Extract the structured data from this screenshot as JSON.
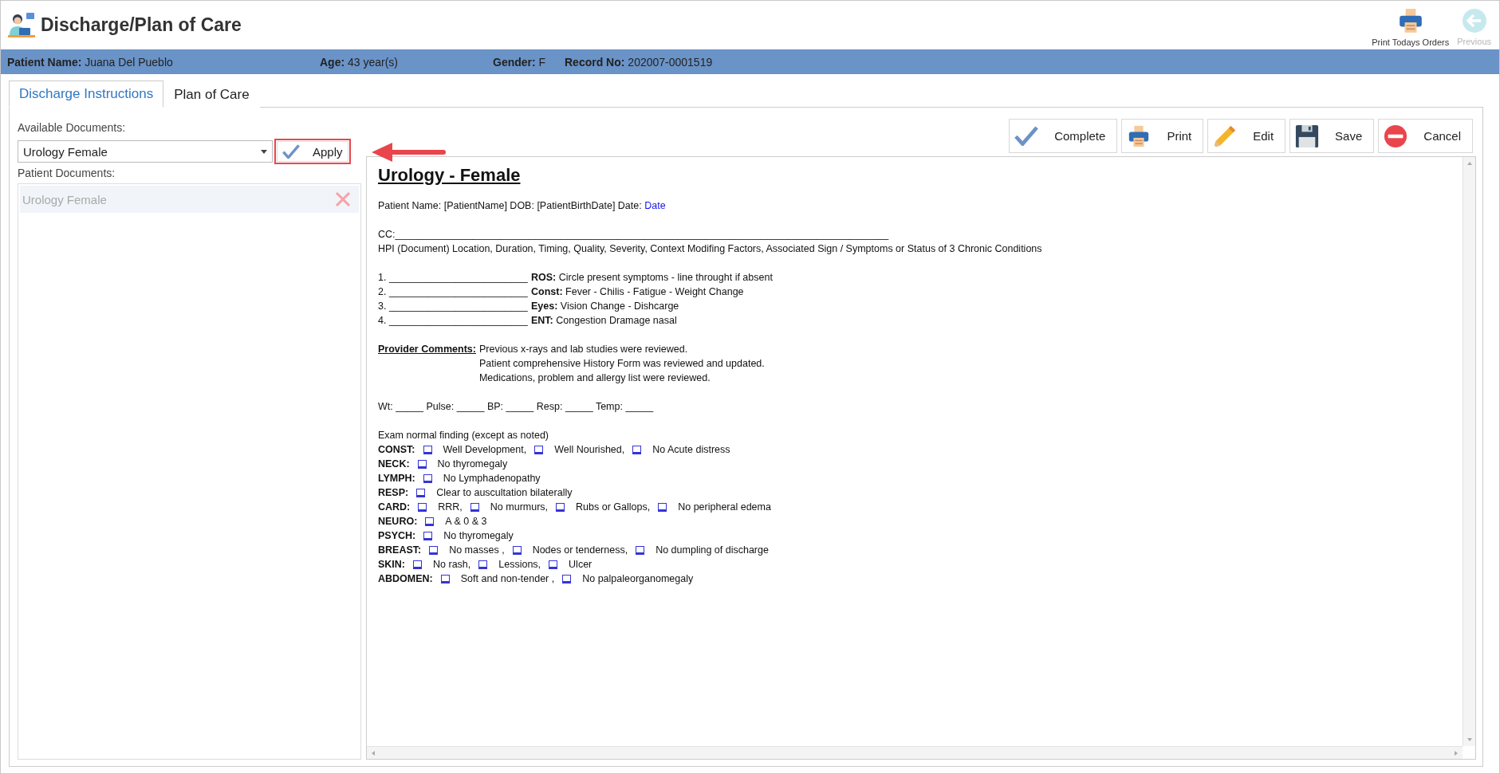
{
  "header": {
    "title": "Discharge/Plan of Care",
    "actions": [
      {
        "label": "Print Todays Orders",
        "disabled": false
      },
      {
        "label": "Previous",
        "disabled": true
      }
    ]
  },
  "patient_bar": [
    {
      "label": "Patient Name:",
      "value": "Juana Del Pueblo"
    },
    {
      "label": "Age:",
      "value": "43 year(s)"
    },
    {
      "label": "Gender:",
      "value": "F"
    },
    {
      "label": "Record No:",
      "value": "202007-0001519"
    }
  ],
  "tabs": [
    {
      "label": "Discharge Instructions",
      "selected": true
    },
    {
      "label": "Plan of Care",
      "selected": false
    }
  ],
  "available_documents": {
    "label": "Available Documents:",
    "value": "Urology Female",
    "apply": "Apply"
  },
  "patient_documents": {
    "label": "Patient Documents:",
    "items": [
      {
        "name": "Urology Female",
        "selected": true
      }
    ]
  },
  "toolbar": [
    "Complete",
    "Print",
    "Edit",
    "Save",
    "Cancel"
  ],
  "document": {
    "title": "Urology - Female",
    "header_line": {
      "text": "Patient Name: [PatientName] DOB: [PatientBirthDate] Date:",
      "link": "Date"
    },
    "cc": "CC:_________________________________________________________________________________________",
    "hpi": "HPI (Document) Location, Duration, Timing, Quality, Severity, Context Modifing Factors, Associated Sign / Symptoms or Status of 3 Chronic Conditions",
    "review": [
      {
        "number": "1.",
        "blank": "_________________________",
        "label": "ROS:",
        "text": "Circle present symptoms - line throught if absent"
      },
      {
        "number": "2.",
        "blank": "_________________________",
        "label": "Const:",
        "text": "Fever - Chilis - Fatigue - Weight Change"
      },
      {
        "number": "3.",
        "blank": "_________________________",
        "label": "Eyes:",
        "text": "Vision Change - Dishcarge"
      },
      {
        "number": "4.",
        "blank": "_________________________",
        "label": "ENT:",
        "text": "Congestion Dramage nasal"
      }
    ],
    "provider_comments": {
      "label": "Provider Comments:",
      "lines": [
        "Previous x-rays and lab studies were reviewed.",
        "Patient comprehensive History Form was reviewed and updated.",
        "Medications, problem and allergy list were reviewed."
      ]
    },
    "vitals": "Wt: _____ Pulse: _____ BP: _____ Resp: _____ Temp: _____",
    "exam": {
      "heading": "Exam normal finding (except as noted)",
      "rows": [
        {
          "label": "CONST:",
          "items": [
            {
              "text": "Well Development,",
              "checked": false
            },
            {
              "text": "Well Nourished,",
              "checked": false
            },
            {
              "text": "No Acute distress",
              "checked": false
            }
          ]
        },
        {
          "label": "NECK:",
          "items": [
            {
              "text": "No thyromegaly",
              "checked": false
            }
          ]
        },
        {
          "label": "LYMPH:",
          "items": [
            {
              "text": "No Lymphadenopathy",
              "checked": false
            }
          ]
        },
        {
          "label": "RESP:",
          "items": [
            {
              "text": "Clear to auscultation bilaterally",
              "checked": false
            }
          ]
        },
        {
          "label": "CARD:",
          "items": [
            {
              "text": "RRR,",
              "checked": false
            },
            {
              "text": "No murmurs,",
              "checked": false
            },
            {
              "text": "Rubs or Gallops,",
              "checked": false
            },
            {
              "text": "No peripheral edema",
              "checked": false
            }
          ]
        },
        {
          "label": "NEURO:",
          "items": [
            {
              "text": "A & 0 & 3",
              "checked": false
            }
          ]
        },
        {
          "label": "PSYCH:",
          "items": [
            {
              "text": "No thyromegaly",
              "checked": false
            }
          ]
        },
        {
          "label": "BREAST:",
          "items": [
            {
              "text": "No masses ,",
              "checked": false
            },
            {
              "text": "Nodes or tenderness,",
              "checked": false
            },
            {
              "text": "No dumpling of discharge",
              "checked": false
            }
          ]
        },
        {
          "label": "SKIN:",
          "items": [
            {
              "text": "No rash,",
              "checked": false
            },
            {
              "text": "Lessions,",
              "checked": false
            },
            {
              "text": "Ulcer",
              "checked": false
            }
          ]
        },
        {
          "label": "ABDOMEN:",
          "items": [
            {
              "text": "Soft and non-tender ,",
              "checked": false
            },
            {
              "text": "No palpaleorganomegaly",
              "checked": false
            }
          ]
        }
      ]
    }
  }
}
